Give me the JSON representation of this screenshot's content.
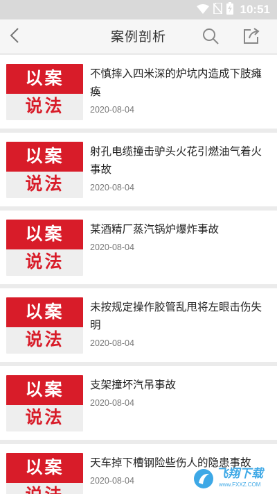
{
  "status_bar": {
    "time": "10:51",
    "icons": [
      "wifi-icon",
      "no-sim-icon",
      "battery-charging-icon"
    ]
  },
  "nav": {
    "title": "案例剖析",
    "icons": [
      "back-arrow-icon",
      "search-icon",
      "share-icon"
    ]
  },
  "thumbnail": {
    "line1": "以案",
    "line2": "说法"
  },
  "articles": [
    {
      "title": "不慎摔入四米深的炉坑内造成下肢瘫痪",
      "date": "2020-08-04"
    },
    {
      "title": "射孔电缆撞击驴头火花引燃油气着火事故",
      "date": "2020-08-04"
    },
    {
      "title": "某酒精厂蒸汽锅炉爆炸事故",
      "date": "2020-08-04"
    },
    {
      "title": "未按规定操作胶管乱甩将左眼击伤失明",
      "date": "2020-08-04"
    },
    {
      "title": "支架撞坏汽吊事故",
      "date": "2020-08-04"
    },
    {
      "title": "天车掉下槽钢险些伤人的隐患事故",
      "date": "2020-08-04"
    }
  ],
  "watermark": {
    "text": "飞翔下载",
    "url": "www.FXXZ.COM"
  },
  "colors": {
    "brand_red": "#d81c29",
    "watermark_blue": "#3da8e6"
  }
}
